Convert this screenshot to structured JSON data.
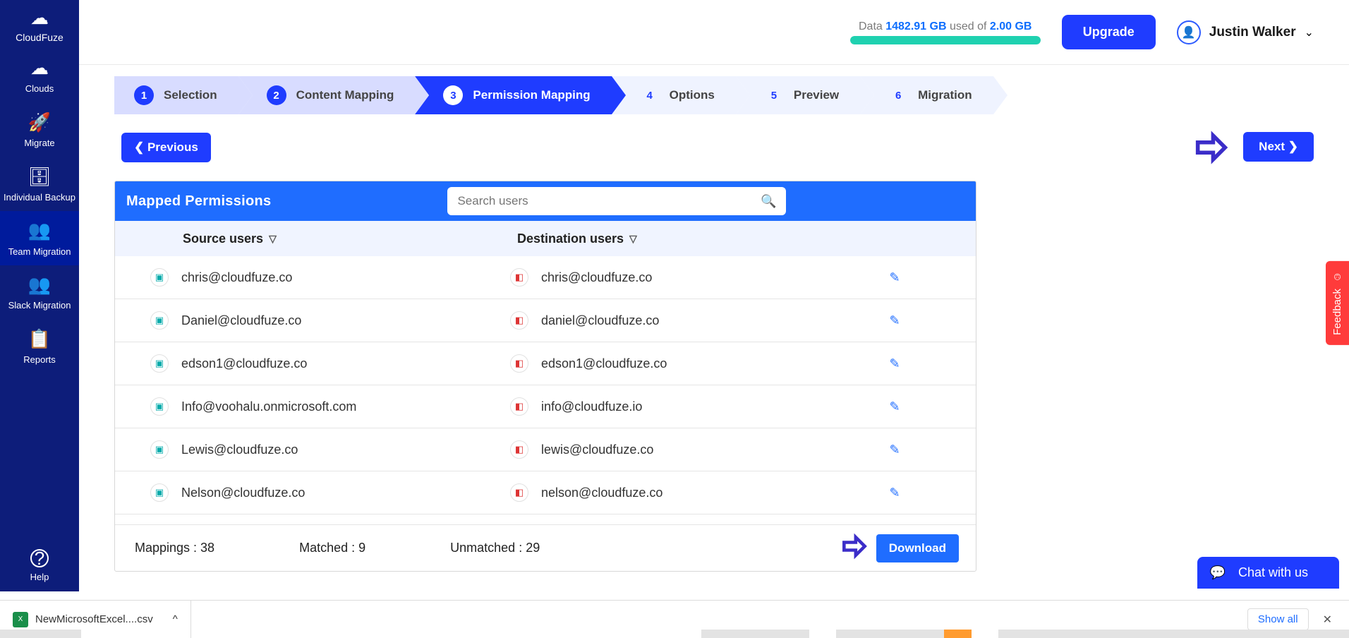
{
  "brand": "CloudFuze",
  "sidebar": [
    {
      "label": "Clouds",
      "icon": "☁"
    },
    {
      "label": "Migrate",
      "icon": "🚀"
    },
    {
      "label": "Individual Backup",
      "icon": "🗄"
    },
    {
      "label": "Team Migration",
      "icon": "👥"
    },
    {
      "label": "Slack Migration",
      "icon": "👥"
    },
    {
      "label": "Reports",
      "icon": "📋"
    },
    {
      "label": "Help",
      "icon": "?"
    }
  ],
  "header": {
    "data_label": "Data ",
    "used_amount": "1482.91 GB",
    "used_of": " used of ",
    "total": "2.00 GB",
    "upgrade": "Upgrade",
    "user": "Justin Walker"
  },
  "steps": [
    {
      "num": "1",
      "label": "Selection"
    },
    {
      "num": "2",
      "label": "Content Mapping"
    },
    {
      "num": "3",
      "label": "Permission Mapping"
    },
    {
      "num": "4",
      "label": "Options"
    },
    {
      "num": "5",
      "label": "Preview"
    },
    {
      "num": "6",
      "label": "Migration"
    }
  ],
  "nav": {
    "prev": "Previous",
    "next": "Next"
  },
  "panel": {
    "title": "Mapped Permissions",
    "search_placeholder": "Search users",
    "col_src": "Source users",
    "col_dst": "Destination users"
  },
  "rows": [
    {
      "src": "chris@cloudfuze.co",
      "dst": "chris@cloudfuze.co"
    },
    {
      "src": "Daniel@cloudfuze.co",
      "dst": "daniel@cloudfuze.co"
    },
    {
      "src": "edson1@cloudfuze.co",
      "dst": "edson1@cloudfuze.co"
    },
    {
      "src": "Info@voohalu.onmicrosoft.com",
      "dst": "info@cloudfuze.io"
    },
    {
      "src": "Lewis@cloudfuze.co",
      "dst": "lewis@cloudfuze.co"
    },
    {
      "src": "Nelson@cloudfuze.co",
      "dst": "nelson@cloudfuze.co"
    }
  ],
  "footer": {
    "mappings": "Mappings : 38",
    "matched": "Matched : 9",
    "unmatched": "Unmatched : 29",
    "download": "Download"
  },
  "feedback": "Feedback",
  "chat": "Chat with us",
  "file": "NewMicrosoftExcel....csv",
  "show_all": "Show all"
}
